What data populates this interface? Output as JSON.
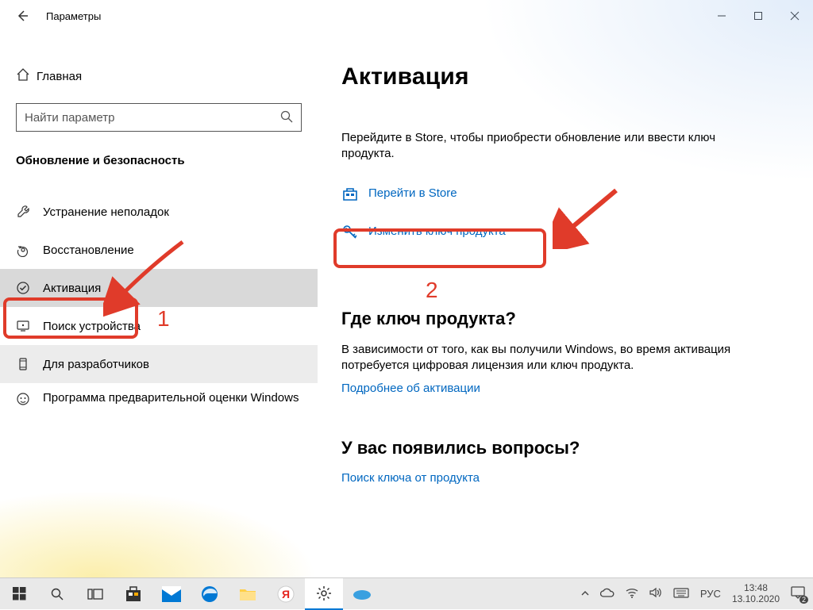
{
  "title": "Параметры",
  "sidebar": {
    "home": "Главная",
    "searchPlaceholder": "Найти параметр",
    "section": "Обновление и безопасность",
    "items": [
      {
        "label": "Устранение неполадок"
      },
      {
        "label": "Восстановление"
      },
      {
        "label": "Активация"
      },
      {
        "label": "Поиск устройства"
      },
      {
        "label": "Для разработчиков"
      },
      {
        "label": "Программа предварительной оценки Windows"
      }
    ]
  },
  "content": {
    "heading": "Активация",
    "intro": "Перейдите в Store, чтобы приобрести обновление или ввести ключ продукта.",
    "storeLink": "Перейти в Store",
    "changeKey": "Изменить ключ продукта",
    "sub1": "Где ключ продукта?",
    "sub1text": "В зависимости от того, как вы получили Windows, во время активация потребуется цифровая лицензия или ключ продукта.",
    "sub1link": "Подробнее об активации",
    "sub2": "У вас появились вопросы?",
    "sub2link": "Поиск ключа от продукта"
  },
  "annotations": {
    "one": "1",
    "two": "2"
  },
  "tray": {
    "lang": "РУС",
    "time": "13:48",
    "date": "13.10.2020",
    "notif": "2"
  }
}
